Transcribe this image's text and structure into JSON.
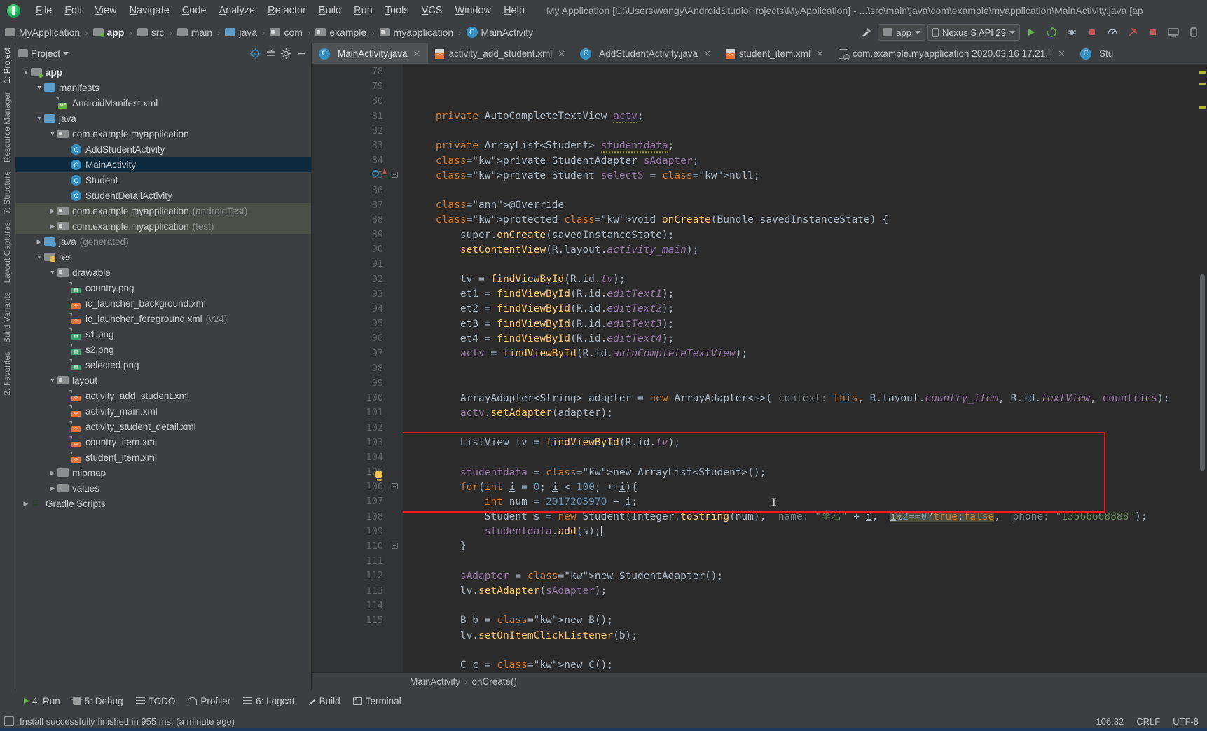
{
  "window": {
    "title": "My Application [C:\\Users\\wangy\\AndroidStudioProjects\\MyApplication] - ...\\src\\main\\java\\com\\example\\myapplication\\MainActivity.java [ap"
  },
  "menubar": {
    "items": [
      "File",
      "Edit",
      "View",
      "Navigate",
      "Code",
      "Analyze",
      "Refactor",
      "Build",
      "Run",
      "Tools",
      "VCS",
      "Window",
      "Help"
    ]
  },
  "breadcrumb": {
    "items": [
      {
        "label": "MyApplication",
        "icon": "folder-icon",
        "bold": false
      },
      {
        "label": "app",
        "icon": "module-icon",
        "bold": true
      },
      {
        "label": "src",
        "icon": "folder-icon",
        "bold": false
      },
      {
        "label": "main",
        "icon": "folder-icon",
        "bold": false
      },
      {
        "label": "java",
        "icon": "folder-blue-icon",
        "bold": false
      },
      {
        "label": "com",
        "icon": "package-icon",
        "bold": false
      },
      {
        "label": "example",
        "icon": "package-icon",
        "bold": false
      },
      {
        "label": "myapplication",
        "icon": "package-icon",
        "bold": false
      },
      {
        "label": "MainActivity",
        "icon": "class-icon",
        "bold": false
      }
    ]
  },
  "toolbar": {
    "run_config": "app",
    "device": "Nexus S API 29",
    "accent_red": "#ee1c25",
    "accent_green": "#62b543",
    "accent_blue": "#3592c4"
  },
  "project_panel": {
    "title": "Project",
    "tree": [
      {
        "indent": 0,
        "arrow": "down",
        "icon": "module-icon",
        "label": "app",
        "suffix": "",
        "bold": true,
        "state": "normal"
      },
      {
        "indent": 1,
        "arrow": "down",
        "icon": "folder-blue-icon",
        "label": "manifests",
        "suffix": "",
        "bold": false,
        "state": "normal"
      },
      {
        "indent": 2,
        "arrow": "none",
        "icon": "manifest-file-icon",
        "label": "AndroidManifest.xml",
        "suffix": "",
        "bold": false,
        "state": "normal"
      },
      {
        "indent": 1,
        "arrow": "down",
        "icon": "folder-blue-icon",
        "label": "java",
        "suffix": "",
        "bold": false,
        "state": "normal"
      },
      {
        "indent": 2,
        "arrow": "down",
        "icon": "package-icon",
        "label": "com.example.myapplication",
        "suffix": "",
        "bold": false,
        "state": "normal"
      },
      {
        "indent": 3,
        "arrow": "none",
        "icon": "class-icon",
        "label": "AddStudentActivity",
        "suffix": "",
        "bold": false,
        "state": "normal"
      },
      {
        "indent": 3,
        "arrow": "none",
        "icon": "class-icon",
        "label": "MainActivity",
        "suffix": "",
        "bold": false,
        "state": "selected"
      },
      {
        "indent": 3,
        "arrow": "none",
        "icon": "class-icon",
        "label": "Student",
        "suffix": "",
        "bold": false,
        "state": "normal"
      },
      {
        "indent": 3,
        "arrow": "none",
        "icon": "class-icon",
        "label": "StudentDetailActivity",
        "suffix": "",
        "bold": false,
        "state": "normal"
      },
      {
        "indent": 2,
        "arrow": "right",
        "icon": "package-icon",
        "label": "com.example.myapplication",
        "suffix": "(androidTest)",
        "bold": false,
        "state": "group"
      },
      {
        "indent": 2,
        "arrow": "right",
        "icon": "package-icon",
        "label": "com.example.myapplication",
        "suffix": "(test)",
        "bold": false,
        "state": "group"
      },
      {
        "indent": 1,
        "arrow": "right",
        "icon": "folder-generated-icon",
        "label": "java",
        "suffix": "(generated)",
        "bold": false,
        "state": "normal"
      },
      {
        "indent": 1,
        "arrow": "down",
        "icon": "res-folder-icon",
        "label": "res",
        "suffix": "",
        "bold": false,
        "state": "normal"
      },
      {
        "indent": 2,
        "arrow": "down",
        "icon": "package-icon",
        "label": "drawable",
        "suffix": "",
        "bold": false,
        "state": "normal"
      },
      {
        "indent": 3,
        "arrow": "none",
        "icon": "png-file-icon",
        "label": "country.png",
        "suffix": "",
        "bold": false,
        "state": "normal"
      },
      {
        "indent": 3,
        "arrow": "none",
        "icon": "xml-file-icon",
        "label": "ic_launcher_background.xml",
        "suffix": "",
        "bold": false,
        "state": "normal"
      },
      {
        "indent": 3,
        "arrow": "none",
        "icon": "xml-file-icon",
        "label": "ic_launcher_foreground.xml",
        "suffix": "(v24)",
        "bold": false,
        "state": "normal"
      },
      {
        "indent": 3,
        "arrow": "none",
        "icon": "png-file-icon",
        "label": "s1.png",
        "suffix": "",
        "bold": false,
        "state": "normal"
      },
      {
        "indent": 3,
        "arrow": "none",
        "icon": "png-file-icon",
        "label": "s2.png",
        "suffix": "",
        "bold": false,
        "state": "normal"
      },
      {
        "indent": 3,
        "arrow": "none",
        "icon": "png-file-icon",
        "label": "selected.png",
        "suffix": "",
        "bold": false,
        "state": "normal"
      },
      {
        "indent": 2,
        "arrow": "down",
        "icon": "package-icon",
        "label": "layout",
        "suffix": "",
        "bold": false,
        "state": "normal"
      },
      {
        "indent": 3,
        "arrow": "none",
        "icon": "xml-file-icon",
        "label": "activity_add_student.xml",
        "suffix": "",
        "bold": false,
        "state": "normal"
      },
      {
        "indent": 3,
        "arrow": "none",
        "icon": "xml-file-icon",
        "label": "activity_main.xml",
        "suffix": "",
        "bold": false,
        "state": "normal"
      },
      {
        "indent": 3,
        "arrow": "none",
        "icon": "xml-file-icon",
        "label": "activity_student_detail.xml",
        "suffix": "",
        "bold": false,
        "state": "normal"
      },
      {
        "indent": 3,
        "arrow": "none",
        "icon": "xml-file-icon",
        "label": "country_item.xml",
        "suffix": "",
        "bold": false,
        "state": "normal"
      },
      {
        "indent": 3,
        "arrow": "none",
        "icon": "xml-file-icon",
        "label": "student_item.xml",
        "suffix": "",
        "bold": false,
        "state": "normal"
      },
      {
        "indent": 2,
        "arrow": "right",
        "icon": "folder-icon",
        "label": "mipmap",
        "suffix": "",
        "bold": false,
        "state": "normal"
      },
      {
        "indent": 2,
        "arrow": "right",
        "icon": "folder-icon",
        "label": "values",
        "suffix": "",
        "bold": false,
        "state": "normal"
      },
      {
        "indent": 0,
        "arrow": "right",
        "icon": "gradle-icon",
        "label": "Gradle Scripts",
        "suffix": "",
        "bold": false,
        "state": "normal"
      }
    ]
  },
  "left_strip": {
    "items": [
      "1: Project",
      "Resource Manager",
      "7: Structure",
      "Layout Captures",
      "Build Variants",
      "2: Favorites"
    ]
  },
  "tabs": [
    {
      "label": "MainActivity.java",
      "icon": "class-icon",
      "active": true
    },
    {
      "label": "activity_add_student.xml",
      "icon": "layout-xml-icon",
      "active": false
    },
    {
      "label": "AddStudentActivity.java",
      "icon": "class-icon",
      "active": false
    },
    {
      "label": "student_item.xml",
      "icon": "layout-xml-icon",
      "active": false
    },
    {
      "label": "com.example.myapplication 2020.03.16 17.21.li",
      "icon": "capture-icon",
      "active": false
    },
    {
      "label": "Stu",
      "icon": "class-icon",
      "active": false
    }
  ],
  "editor": {
    "first_line": 78,
    "lines": [
      {
        "n": 78,
        "text": "    private AutoCompleteTextView actv;"
      },
      {
        "n": 79,
        "text": ""
      },
      {
        "n": 80,
        "text": "    private ArrayList<Student> studentdata;"
      },
      {
        "n": 81,
        "text": "    private StudentAdapter sAdapter;"
      },
      {
        "n": 82,
        "text": "    private Student selectS = null;"
      },
      {
        "n": 83,
        "text": ""
      },
      {
        "n": 84,
        "text": "    @Override"
      },
      {
        "n": 85,
        "text": "    protected void onCreate(Bundle savedInstanceState) {"
      },
      {
        "n": 86,
        "text": "        super.onCreate(savedInstanceState);"
      },
      {
        "n": 87,
        "text": "        setContentView(R.layout.activity_main);"
      },
      {
        "n": 88,
        "text": ""
      },
      {
        "n": 89,
        "text": "        tv = findViewById(R.id.tv);"
      },
      {
        "n": 90,
        "text": "        et1 = findViewById(R.id.editText1);"
      },
      {
        "n": 91,
        "text": "        et2 = findViewById(R.id.editText2);"
      },
      {
        "n": 92,
        "text": "        et3 = findViewById(R.id.editText3);"
      },
      {
        "n": 93,
        "text": "        et4 = findViewById(R.id.editText4);"
      },
      {
        "n": 94,
        "text": "        actv = findViewById(R.id.autoCompleteTextView);"
      },
      {
        "n": 95,
        "text": ""
      },
      {
        "n": 96,
        "text": ""
      },
      {
        "n": 97,
        "text": "        ArrayAdapter<String> adapter = new ArrayAdapter<~>( context: this, R.layout.country_item, R.id.textView, countries);"
      },
      {
        "n": 98,
        "text": "        actv.setAdapter(adapter);"
      },
      {
        "n": 99,
        "text": ""
      },
      {
        "n": 100,
        "text": "        ListView lv = findViewById(R.id.lv);"
      },
      {
        "n": 101,
        "text": ""
      },
      {
        "n": 102,
        "text": "        studentdata = new ArrayList<Student>();"
      },
      {
        "n": 103,
        "text": "        for(int i = 0; i < 100; ++i){"
      },
      {
        "n": 104,
        "text": "            int num = 2017205970 + i;"
      },
      {
        "n": 105,
        "text": "            Student s = new Student(Integer.toString(num),  name: \"李岩\" + i,  i%2==0?true:false,  phone: \"13566668888\");"
      },
      {
        "n": 106,
        "text": "            studentdata.add(s);"
      },
      {
        "n": 107,
        "text": "        }"
      },
      {
        "n": 108,
        "text": ""
      },
      {
        "n": 109,
        "text": "        sAdapter = new StudentAdapter();"
      },
      {
        "n": 110,
        "text": "        lv.setAdapter(sAdapter);"
      },
      {
        "n": 111,
        "text": ""
      },
      {
        "n": 112,
        "text": "        B b = new B();"
      },
      {
        "n": 113,
        "text": "        lv.setOnItemClickListener(b);"
      },
      {
        "n": 114,
        "text": ""
      },
      {
        "n": 115,
        "text": "        C c = new C();"
      }
    ],
    "highlight_box_lines": [
      103,
      107
    ],
    "highlight_box_color": "#ee1c25",
    "caret_line": 106
  },
  "editor_breadcrumb": {
    "items": [
      "MainActivity",
      "onCreate()"
    ]
  },
  "bottom_tools": [
    {
      "label": "4: Run",
      "icon": "run-icon",
      "underline": "4"
    },
    {
      "label": "5: Debug",
      "icon": "debug-icon",
      "underline": "5"
    },
    {
      "label": "TODO",
      "icon": "todo-icon",
      "underline": ""
    },
    {
      "label": "Profiler",
      "icon": "profiler-icon",
      "underline": ""
    },
    {
      "label": "6: Logcat",
      "icon": "logcat-icon",
      "underline": "6"
    },
    {
      "label": "Build",
      "icon": "build-icon",
      "underline": ""
    },
    {
      "label": "Terminal",
      "icon": "terminal-icon",
      "underline": ""
    }
  ],
  "statusbar": {
    "message": "Install successfully finished in 955 ms. (a minute ago)",
    "caret_position": "106:32",
    "line_separator": "CRLF",
    "encoding": "UTF-8"
  }
}
